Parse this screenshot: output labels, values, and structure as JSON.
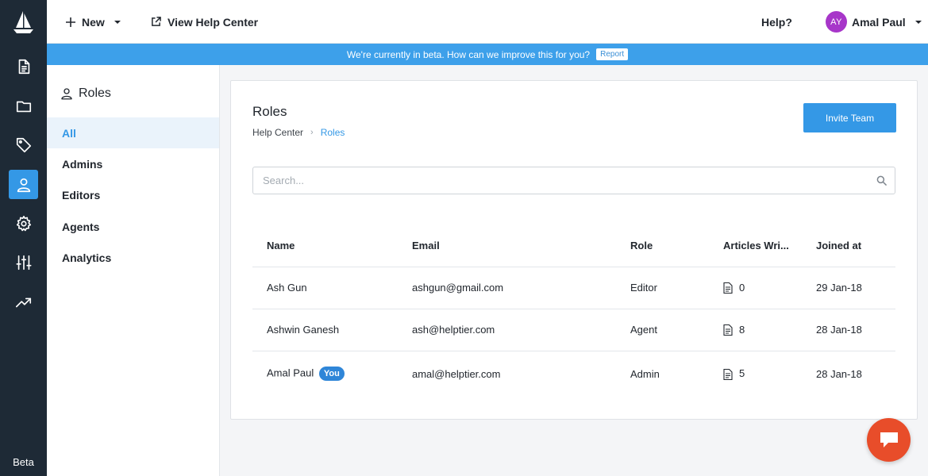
{
  "rail": {
    "items": [
      {
        "name": "articles-icon"
      },
      {
        "name": "folder-icon"
      },
      {
        "name": "tag-icon"
      },
      {
        "name": "user-icon",
        "active": true
      },
      {
        "name": "gear-icon"
      },
      {
        "name": "sliders-icon"
      },
      {
        "name": "trending-icon"
      }
    ],
    "beta_label": "Beta"
  },
  "topbar": {
    "new_label": "New",
    "view_help_label": "View Help Center",
    "help_label": "Help?",
    "user": {
      "initials": "AY",
      "name": "Amal Paul"
    }
  },
  "banner": {
    "text": "We're currently in beta. How can we improve this for you?",
    "report_label": "Report"
  },
  "sidebar": {
    "title": "Roles",
    "items": [
      {
        "label": "All",
        "active": true
      },
      {
        "label": "Admins"
      },
      {
        "label": "Editors"
      },
      {
        "label": "Agents"
      },
      {
        "label": "Analytics"
      }
    ]
  },
  "main": {
    "title": "Roles",
    "breadcrumb": {
      "root": "Help Center",
      "separator": "›",
      "current": "Roles"
    },
    "invite_label": "Invite Team",
    "search_placeholder": "Search...",
    "table": {
      "headers": [
        "Name",
        "Email",
        "Role",
        "Articles Wri...",
        "Joined at"
      ],
      "rows": [
        {
          "name": "Ash Gun",
          "badge": "",
          "email": "ashgun@gmail.com",
          "role": "Editor",
          "articles": "0",
          "joined": "29 Jan-18"
        },
        {
          "name": "Ashwin Ganesh",
          "badge": "",
          "email": "ash@helptier.com",
          "role": "Agent",
          "articles": "8",
          "joined": "28 Jan-18"
        },
        {
          "name": "Amal Paul",
          "badge": "You",
          "email": "amal@helptier.com",
          "role": "Admin",
          "articles": "5",
          "joined": "28 Jan-18"
        }
      ]
    }
  },
  "colors": {
    "rail_bg": "#1e2a36",
    "accent": "#3498e6",
    "banner": "#3da0ea",
    "avatar": "#a736c9",
    "chat": "#e84d2a"
  }
}
